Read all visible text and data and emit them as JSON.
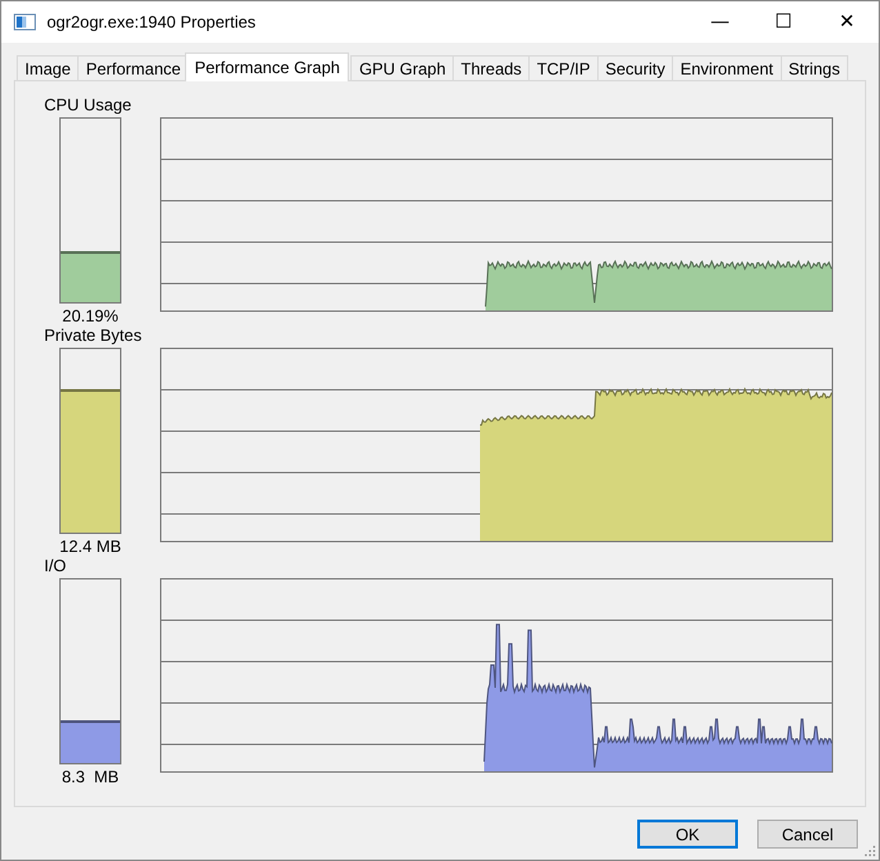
{
  "window": {
    "title": "ogr2ogr.exe:1940 Properties",
    "controls": [
      "—",
      "☐",
      "✕"
    ]
  },
  "tabs": [
    {
      "label": "Image",
      "selected": false
    },
    {
      "label": "Performance",
      "selected": false
    },
    {
      "label": "Performance Graph",
      "selected": true
    },
    {
      "label": "GPU Graph",
      "selected": false
    },
    {
      "label": "Threads",
      "selected": false
    },
    {
      "label": "TCP/IP",
      "selected": false
    },
    {
      "label": "Security",
      "selected": false
    },
    {
      "label": "Environment",
      "selected": false
    },
    {
      "label": "Strings",
      "selected": false
    }
  ],
  "graphs": [
    {
      "label": "CPU Usage",
      "reading": "20.19%",
      "level": 0.28,
      "color": "#a0cc9c",
      "kind": "cpu"
    },
    {
      "label": "Private Bytes",
      "reading": "12.4 MB",
      "level": 0.78,
      "color": "#d6d67c",
      "kind": "memory"
    },
    {
      "label": "I/O",
      "reading": "8.3  MB",
      "level": 0.23,
      "color": "#8e9ae6",
      "kind": "io"
    }
  ],
  "buttons": [
    {
      "label": "OK",
      "kind": "default"
    },
    {
      "label": "Cancel",
      "kind": "normal"
    }
  ]
}
